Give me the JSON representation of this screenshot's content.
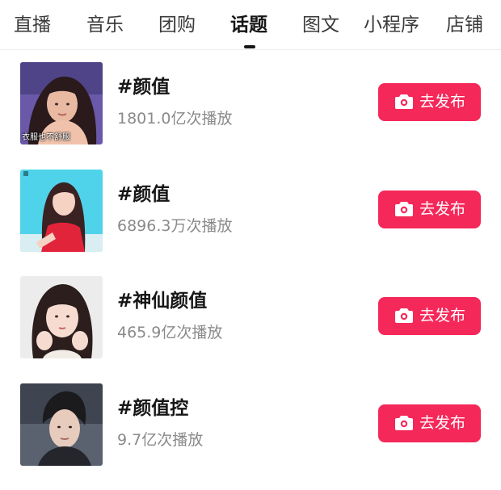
{
  "tabs": [
    {
      "label": "直播"
    },
    {
      "label": "音乐"
    },
    {
      "label": "团购"
    },
    {
      "label": "话题",
      "active": true
    },
    {
      "label": "图文"
    },
    {
      "label": "小程序"
    },
    {
      "label": "店铺"
    }
  ],
  "topics": [
    {
      "title": "#颜值",
      "plays": "1801.0亿次播放",
      "button": "去发布",
      "thumb_caption": "衣服也不舒服"
    },
    {
      "title": "#颜值",
      "plays": "6896.3万次播放",
      "button": "去发布"
    },
    {
      "title": "#神仙颜值",
      "plays": "465.9亿次播放",
      "button": "去发布"
    },
    {
      "title": "#颜值控",
      "plays": "9.7亿次播放",
      "button": "去发布"
    }
  ],
  "colors": {
    "accent": "#f5285a",
    "text_primary": "#161616",
    "text_secondary": "#8a8a8a"
  },
  "icons": {
    "publish": "camera-icon"
  }
}
